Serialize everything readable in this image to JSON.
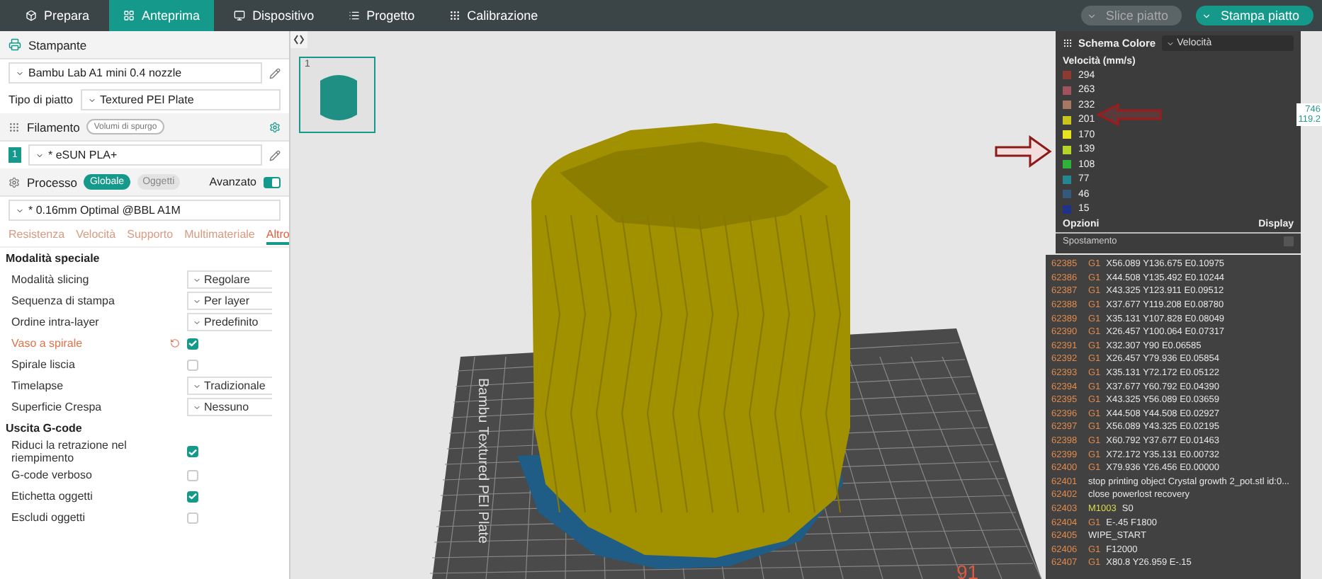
{
  "nav": {
    "tabs": [
      {
        "label": "Prepara",
        "selected": false
      },
      {
        "label": "Anteprima",
        "selected": true
      },
      {
        "label": "Dispositivo",
        "selected": false
      },
      {
        "label": "Progetto",
        "selected": false
      },
      {
        "label": "Calibrazione",
        "selected": false
      }
    ],
    "actions": [
      {
        "label": "Slice piatto",
        "disabled": true
      },
      {
        "label": "Stampa piatto",
        "disabled": false
      }
    ]
  },
  "sidebar": {
    "printer": {
      "title": "Stampante",
      "model": "Bambu Lab A1 mini 0.4 nozzle",
      "plate_label": "Tipo di piatto",
      "plate": "Textured PEI Plate"
    },
    "filament": {
      "title": "Filamento",
      "purge_button": "Volumi di spurgo",
      "slots": [
        {
          "index": "1",
          "name": "* eSUN PLA+"
        }
      ]
    },
    "process": {
      "title": "Processo",
      "scope": [
        {
          "label": "Globale",
          "selected": true
        },
        {
          "label": "Oggetti",
          "selected": false
        }
      ],
      "advanced_label": "Avanzato",
      "advanced": true,
      "preset": "* 0.16mm Optimal @BBL A1M"
    },
    "tabs": [
      {
        "label": "Resistenza",
        "selected": false
      },
      {
        "label": "Velocità",
        "selected": false
      },
      {
        "label": "Supporto",
        "selected": false
      },
      {
        "label": "Multimateriale",
        "selected": false
      },
      {
        "label": "Altro",
        "selected": true
      }
    ],
    "groups": [
      {
        "title": "Modalità speciale",
        "rows": [
          {
            "kind": "select",
            "label": "Modalità slicing",
            "value": "Regolare",
            "modified": false
          },
          {
            "kind": "select",
            "label": "Sequenza di stampa",
            "value": "Per layer",
            "modified": false
          },
          {
            "kind": "select",
            "label": "Ordine intra-layer",
            "value": "Predefinito",
            "modified": false
          },
          {
            "kind": "check",
            "label": "Vaso a spirale",
            "checked": true,
            "modified": true
          },
          {
            "kind": "check",
            "label": "Spirale liscia",
            "checked": false,
            "modified": false
          },
          {
            "kind": "select",
            "label": "Timelapse",
            "value": "Tradizionale",
            "modified": false
          },
          {
            "kind": "select",
            "label": "Superficie Crespa",
            "value": "Nessuno",
            "modified": false
          }
        ]
      },
      {
        "title": "Uscita G-code",
        "rows": [
          {
            "kind": "check",
            "label": "Riduci la retrazione nel riempimento",
            "checked": true,
            "modified": false
          },
          {
            "kind": "check",
            "label": "G-code verboso",
            "checked": false,
            "modified": false
          },
          {
            "kind": "check",
            "label": "Etichetta oggetti",
            "checked": true,
            "modified": false
          },
          {
            "kind": "check",
            "label": "Escludi oggetti",
            "checked": false,
            "modified": false
          }
        ]
      }
    ]
  },
  "plates": [
    {
      "number": "1",
      "selected": true
    }
  ],
  "viewport": {
    "plate_text": "Bambu Textured PEI Plate",
    "plate_number": "91",
    "readouts": [
      "746",
      "119.2"
    ]
  },
  "legend": {
    "title": "Schema Colore",
    "scheme": "Velocità",
    "heading": "Velocità (mm/s)",
    "items": [
      {
        "label": "294",
        "color": "#8c3b32"
      },
      {
        "label": "263",
        "color": "#a0535c"
      },
      {
        "label": "232",
        "color": "#a67a62"
      },
      {
        "label": "201",
        "color": "#c9c31e"
      },
      {
        "label": "170",
        "color": "#e9e31f"
      },
      {
        "label": "139",
        "color": "#b4d42a"
      },
      {
        "label": "108",
        "color": "#2fb13a"
      },
      {
        "label": "77",
        "color": "#24878f"
      },
      {
        "label": "46",
        "color": "#34597a"
      },
      {
        "label": "15",
        "color": "#1f3489"
      }
    ],
    "options_label": "Opzioni",
    "display_label": "Display",
    "options": [
      {
        "label": "Spostamento",
        "checked": false
      }
    ]
  },
  "gcode": [
    {
      "num": "62385",
      "cmd": "G1",
      "args": "X56.089 Y136.675 E0.10975"
    },
    {
      "num": "62386",
      "cmd": "G1",
      "args": "X44.508 Y135.492 E0.10244"
    },
    {
      "num": "62387",
      "cmd": "G1",
      "args": "X43.325 Y123.911 E0.09512"
    },
    {
      "num": "62388",
      "cmd": "G1",
      "args": "X37.677 Y119.208 E0.08780"
    },
    {
      "num": "62389",
      "cmd": "G1",
      "args": "X35.131 Y107.828 E0.08049"
    },
    {
      "num": "62390",
      "cmd": "G1",
      "args": "X26.457 Y100.064 E0.07317"
    },
    {
      "num": "62391",
      "cmd": "G1",
      "args": "X32.307 Y90 E0.06585"
    },
    {
      "num": "62392",
      "cmd": "G1",
      "args": "X26.457 Y79.936 E0.05854"
    },
    {
      "num": "62393",
      "cmd": "G1",
      "args": "X35.131 Y72.172 E0.05122"
    },
    {
      "num": "62394",
      "cmd": "G1",
      "args": "X37.677 Y60.792 E0.04390"
    },
    {
      "num": "62395",
      "cmd": "G1",
      "args": "X43.325 Y56.089 E0.03659"
    },
    {
      "num": "62396",
      "cmd": "G1",
      "args": "X44.508 Y44.508 E0.02927"
    },
    {
      "num": "62397",
      "cmd": "G1",
      "args": "X56.089 Y43.325 E0.02195"
    },
    {
      "num": "62398",
      "cmd": "G1",
      "args": "X60.792 Y37.677 E0.01463"
    },
    {
      "num": "62399",
      "cmd": "G1",
      "args": "X72.172 Y35.131 E0.00732"
    },
    {
      "num": "62400",
      "cmd": "G1",
      "args": "X79.936 Y26.456 E0.00000"
    },
    {
      "num": "62401",
      "args": "stop printing object Crystal growth 2_pot.stl id:0..."
    },
    {
      "num": "62402",
      "args": "close powerlost recovery"
    },
    {
      "num": "62403",
      "cmd": "M1003",
      "args": "S0"
    },
    {
      "num": "62404",
      "cmd": "G1",
      "args": "E-.45 F1800"
    },
    {
      "num": "62405",
      "args": "WIPE_START"
    },
    {
      "num": "62406",
      "cmd": "G1",
      "args": "F12000"
    },
    {
      "num": "62407",
      "cmd": "G1",
      "args": "X80.8 Y26.959 E-.15"
    }
  ]
}
